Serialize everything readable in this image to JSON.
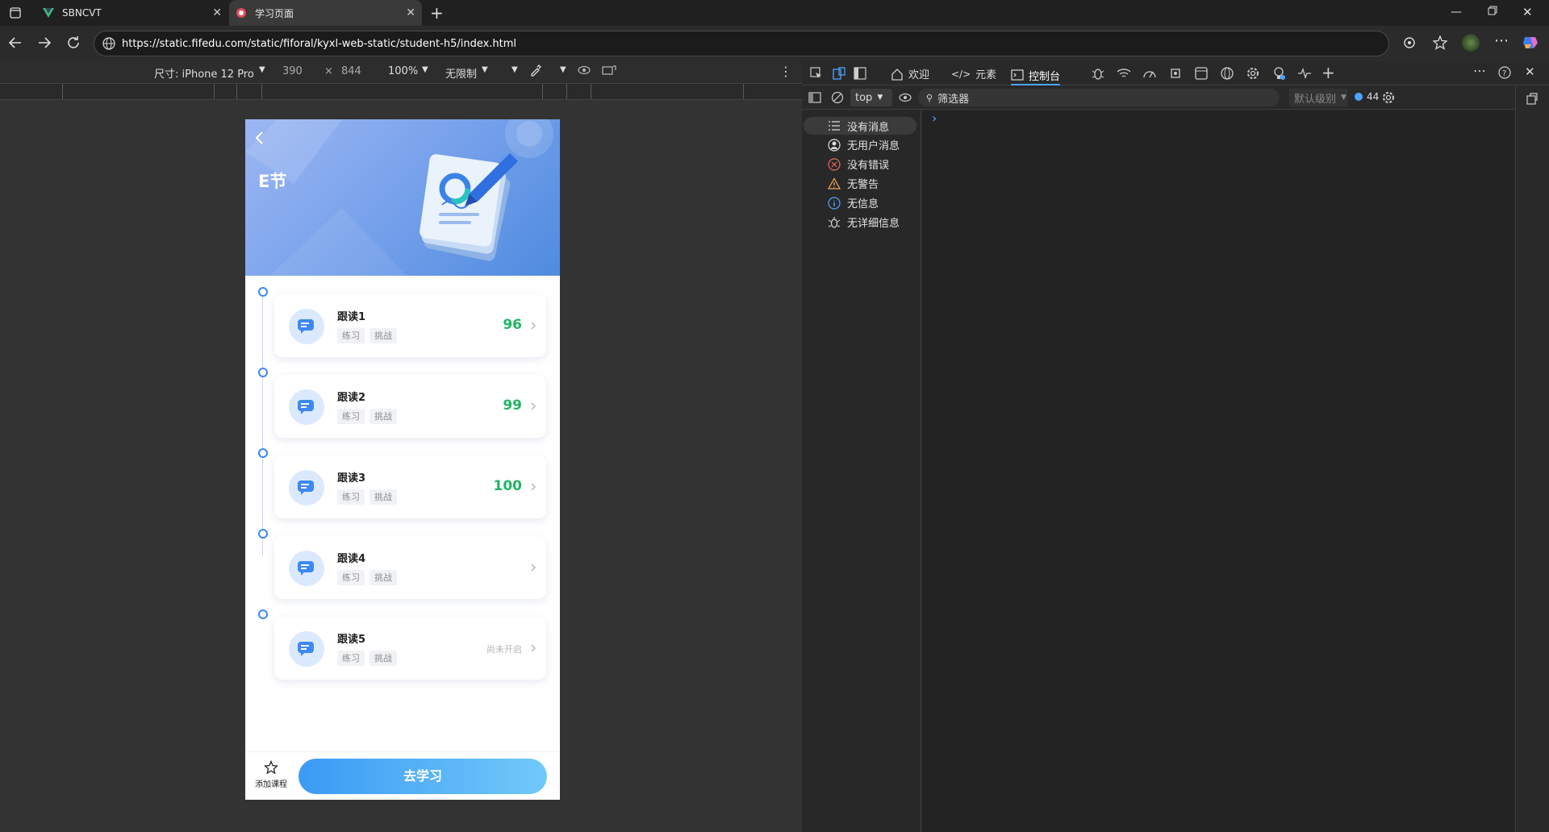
{
  "browser": {
    "tabs": [
      {
        "label": "SBNCVT",
        "icon": "vue-logo-icon"
      },
      {
        "label": "学习页面",
        "icon": "page-favicon-icon",
        "active": true
      }
    ],
    "url": "https://static.fifedu.com/static/fiforal/kyxl-web-static/student-h5/index.html"
  },
  "device_toolbar": {
    "dimensions_label": "尺寸: iPhone 12 Pro",
    "width": "390",
    "times": "×",
    "height": "844",
    "zoom": "100%",
    "throttle": "无限制"
  },
  "phone": {
    "title": "E节",
    "items": [
      {
        "name": "跟读1",
        "tags": [
          "练习",
          "挑战"
        ],
        "score": "96",
        "status": ""
      },
      {
        "name": "跟读2",
        "tags": [
          "练习",
          "挑战"
        ],
        "score": "99",
        "status": ""
      },
      {
        "name": "跟读3",
        "tags": [
          "练习",
          "挑战"
        ],
        "score": "100",
        "status": ""
      },
      {
        "name": "跟读4",
        "tags": [
          "练习",
          "挑战"
        ],
        "score": "",
        "status": ""
      },
      {
        "name": "跟读5",
        "tags": [
          "练习",
          "挑战"
        ],
        "score": "",
        "status": "尚未开启"
      }
    ],
    "add_course_label": "添加课程",
    "go_learn_label": "去学习",
    "score_color": "#22b563",
    "accent": "#3d88f5"
  },
  "devtools": {
    "tabs": {
      "welcome": "欢迎",
      "elements": "元素",
      "console": "控制台"
    },
    "context": "top",
    "filter_placeholder": "筛选器",
    "level": "默认级别",
    "message_count": "44",
    "sidebar": [
      {
        "label": "没有消息",
        "icon": "list-icon"
      },
      {
        "label": "无用户消息",
        "icon": "user-icon"
      },
      {
        "label": "没有错误",
        "icon": "error-icon"
      },
      {
        "label": "无警告",
        "icon": "warning-icon"
      },
      {
        "label": "无信息",
        "icon": "info-icon"
      },
      {
        "label": "无详细信息",
        "icon": "bug-icon"
      }
    ],
    "prompt": "›"
  }
}
